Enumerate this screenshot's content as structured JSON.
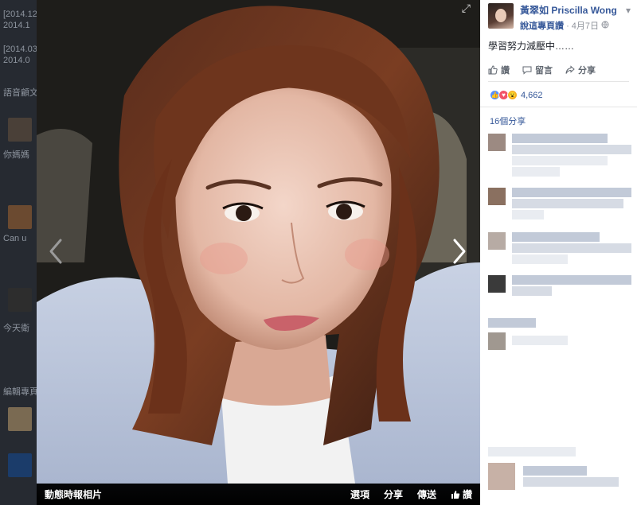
{
  "background_page": {
    "lines": [
      "[2014.12",
      "2014.1",
      "[2014.03",
      "2014.0",
      "語音顧文",
      "你媽媽",
      "Can u",
      "今天衛",
      "編輯專頁推"
    ]
  },
  "viewer": {
    "album_label": "動態時報相片",
    "options_label": "選項",
    "share_label": "分享",
    "send_label": "傳送",
    "like_label": "讚",
    "expand_icon": "expand-icon",
    "prev_icon": "chevron-left-icon",
    "next_icon": "chevron-right-icon"
  },
  "post": {
    "author_name": "黃翠如 Priscilla Wong",
    "like_page_label": "說這專頁讚",
    "separator": "·",
    "date": "4月7日",
    "text": "學習努力減壓中……",
    "actions": {
      "like": "讚",
      "comment": "留言",
      "share": "分享"
    },
    "reaction_count": "4,662",
    "shares_label": "16個分享"
  },
  "colors": {
    "link": "#365899",
    "like_blue": "#5890ff",
    "love_red": "#f25268",
    "wow_yellow": "#f7b125"
  }
}
